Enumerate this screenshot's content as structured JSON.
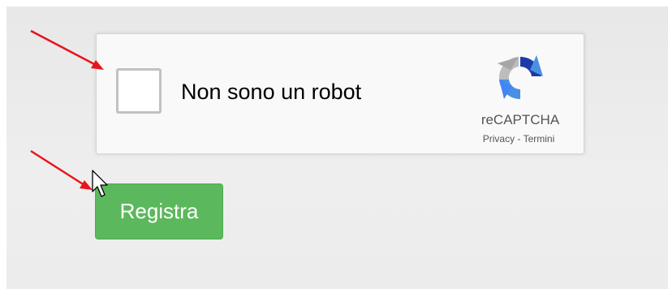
{
  "captcha": {
    "checkbox_label": "Non sono un robot",
    "brand": "reCAPTCHA",
    "privacy_link": "Privacy",
    "separator": " - ",
    "terms_link": "Termini",
    "checked": false
  },
  "form": {
    "submit_label": "Registra",
    "submit_color": "#5cb85c"
  },
  "annotations": {
    "arrow_color": "#e8141c",
    "icons": [
      "red-arrow-icon",
      "red-arrow-icon",
      "mouse-cursor-icon"
    ]
  }
}
